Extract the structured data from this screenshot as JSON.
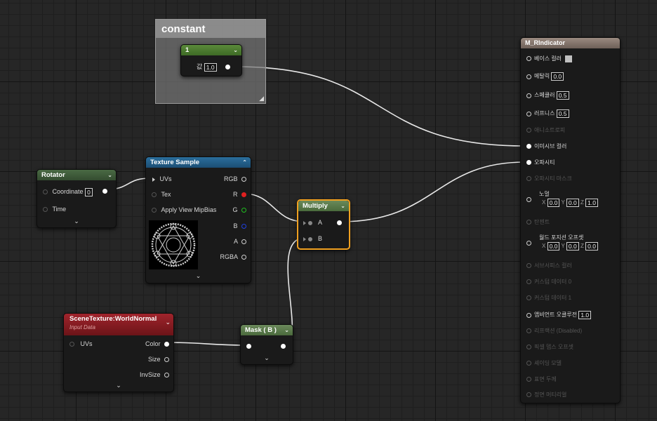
{
  "comment_box": {
    "title": "constant"
  },
  "const_node": {
    "value_display": "1",
    "field_label": "값",
    "field_value": "1.0"
  },
  "rotator": {
    "title": "Rotator",
    "inputs": [
      "Coordinate",
      "Time"
    ],
    "coordinate_value": "0"
  },
  "texture_sample": {
    "title": "Texture Sample",
    "inputs": [
      "UVs",
      "Tex",
      "Apply View MipBias"
    ],
    "outputs": [
      "RGB",
      "R",
      "G",
      "B",
      "A",
      "RGBA"
    ]
  },
  "multiply": {
    "title": "Multiply",
    "inputs": [
      "A",
      "B"
    ]
  },
  "scene_texture": {
    "title": "SceneTexture:WorldNormal",
    "subtitle": "Input Data",
    "inputs": [
      "UVs"
    ],
    "outputs": [
      "Color",
      "Size",
      "InvSize"
    ]
  },
  "mask": {
    "title": "Mask ( B )"
  },
  "material": {
    "title": "M_RIndicator",
    "pins": [
      {
        "label": "베이스 컬러",
        "value": "",
        "enabled": true
      },
      {
        "label": "메탈릭",
        "value": "0.0",
        "enabled": true
      },
      {
        "label": "스페큘러",
        "value": "0.5",
        "enabled": true
      },
      {
        "label": "러프니스",
        "value": "0.5",
        "enabled": true
      },
      {
        "label": "애니소트로피",
        "value": "",
        "enabled": false
      },
      {
        "label": "이미시브 컬러",
        "value": "",
        "enabled": true
      },
      {
        "label": "오파시티",
        "value": "",
        "enabled": true
      },
      {
        "label": "오파시티 마스크",
        "value": "",
        "enabled": false
      },
      {
        "label": "노멀",
        "value": "",
        "enabled": true
      },
      {
        "label": "탄젠트",
        "value": "",
        "enabled": false
      },
      {
        "label": "월드 포지션 오프셋",
        "value": "",
        "enabled": true
      },
      {
        "label": "서브서피스 컬러",
        "value": "",
        "enabled": false
      },
      {
        "label": "커스텀 데이터 0",
        "value": "",
        "enabled": false
      },
      {
        "label": "커스텀 데이터 1",
        "value": "",
        "enabled": false
      },
      {
        "label": "앰비언트 오클루전",
        "value": "1.0",
        "enabled": true
      },
      {
        "label": "리프랙션 (Disabled)",
        "value": "",
        "enabled": false
      },
      {
        "label": "픽셀 뎁스 오프셋",
        "value": "",
        "enabled": false
      },
      {
        "label": "셰이딩 모델",
        "value": "",
        "enabled": false
      },
      {
        "label": "표면 두께",
        "value": "",
        "enabled": false
      },
      {
        "label": "정면 머티리얼",
        "value": "",
        "enabled": false
      }
    ],
    "normal_xyz": {
      "x_label": "X",
      "x": "0.0",
      "y_label": "Y",
      "y": "0.0",
      "z_label": "Z",
      "z": "1.0"
    },
    "wpo_xyz": {
      "x_label": "X",
      "x": "0.0",
      "y_label": "Y",
      "y": "0.0",
      "z_label": "Z",
      "z": "0.0"
    }
  },
  "colors": {
    "mat_header": "#8a7a70",
    "param_green": "#4a7a2e",
    "texture_blue": "#205a86",
    "scene_red": "#8a1c22",
    "mask_gray": "#7a7a7a",
    "select_orange": "#f0a020"
  }
}
